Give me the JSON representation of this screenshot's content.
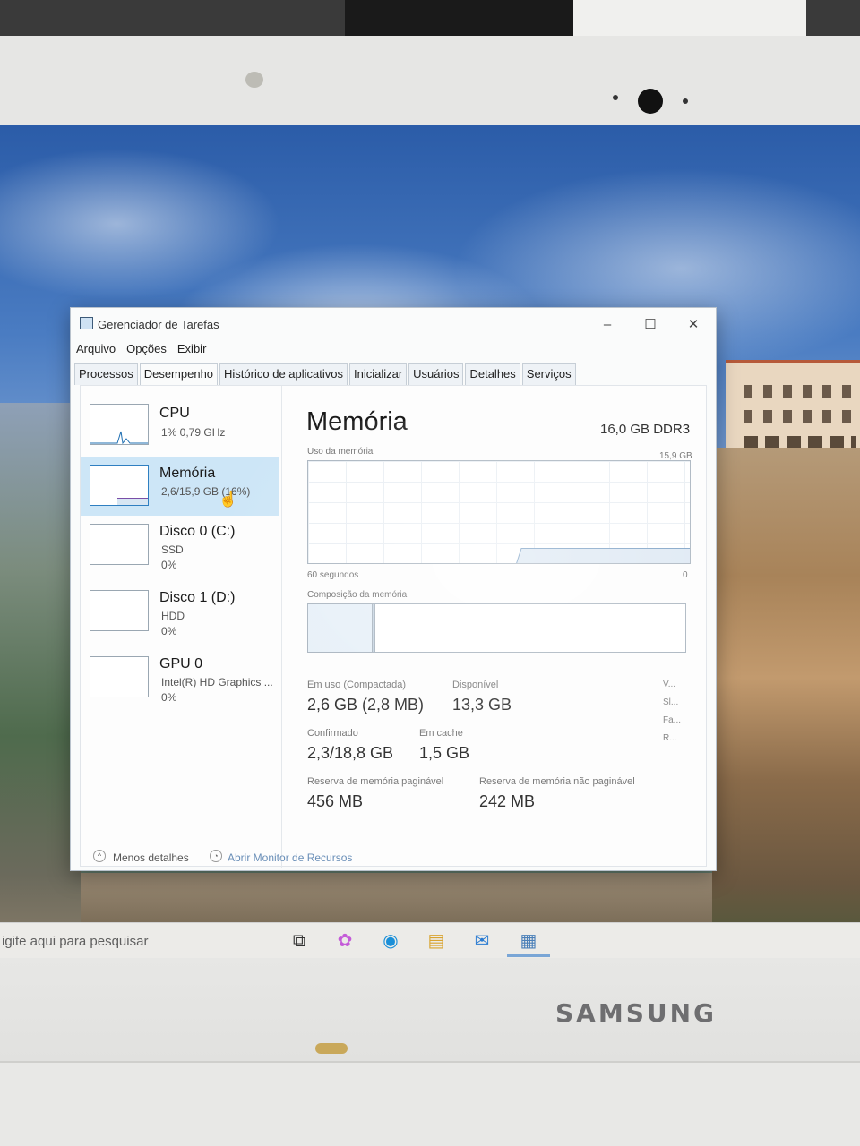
{
  "window": {
    "title": "Gerenciador de Tarefas",
    "minimize": "–",
    "maximize": "☐",
    "close": "✕"
  },
  "menu": [
    "Arquivo",
    "Opções",
    "Exibir"
  ],
  "tabs": [
    "Processos",
    "Desempenho",
    "Histórico de aplicativos",
    "Inicializar",
    "Usuários",
    "Detalhes",
    "Serviços"
  ],
  "active_tab": "Desempenho",
  "sidebar": [
    {
      "title": "CPU",
      "line1": "1% 0,79 GHz",
      "line2": ""
    },
    {
      "title": "Memória",
      "line1": "2,6/15,9 GB (16%)",
      "line2": ""
    },
    {
      "title": "Disco 0 (C:)",
      "line1": "SSD",
      "line2": "0%"
    },
    {
      "title": "Disco 1 (D:)",
      "line1": "HDD",
      "line2": "0%"
    },
    {
      "title": "GPU 0",
      "line1": "Intel(R) HD Graphics ...",
      "line2": "0%"
    }
  ],
  "memory": {
    "title": "Memória",
    "spec": "16,0 GB DDR3",
    "usage_label": "Uso da memória",
    "usage_max": "15,9 GB",
    "time_label": "60 segundos",
    "zero_label": "0",
    "composition_label": "Composição da memória",
    "usage_fraction": 0.16
  },
  "stats": {
    "in_use_label": "Em uso (Compactada)",
    "in_use_value": "2,6 GB (2,8 MB)",
    "available_label": "Disponível",
    "available_value": "13,3 GB",
    "committed_label": "Confirmado",
    "committed_value": "2,3/18,8 GB",
    "cached_label": "Em cache",
    "cached_value": "1,5 GB",
    "paged_label": "Reserva de memória paginável",
    "paged_value": "456 MB",
    "nonpaged_label": "Reserva de memória não paginável",
    "nonpaged_value": "242 MB",
    "side_labels": [
      "V...",
      "Sl...",
      "Fa...",
      "R..."
    ]
  },
  "footer": {
    "less_details": "Menos detalhes",
    "resource_monitor": "Abrir Monitor de Recursos"
  },
  "taskbar": {
    "search_text": "igite aqui para pesquisar"
  },
  "brand": "SAMSUNG"
}
